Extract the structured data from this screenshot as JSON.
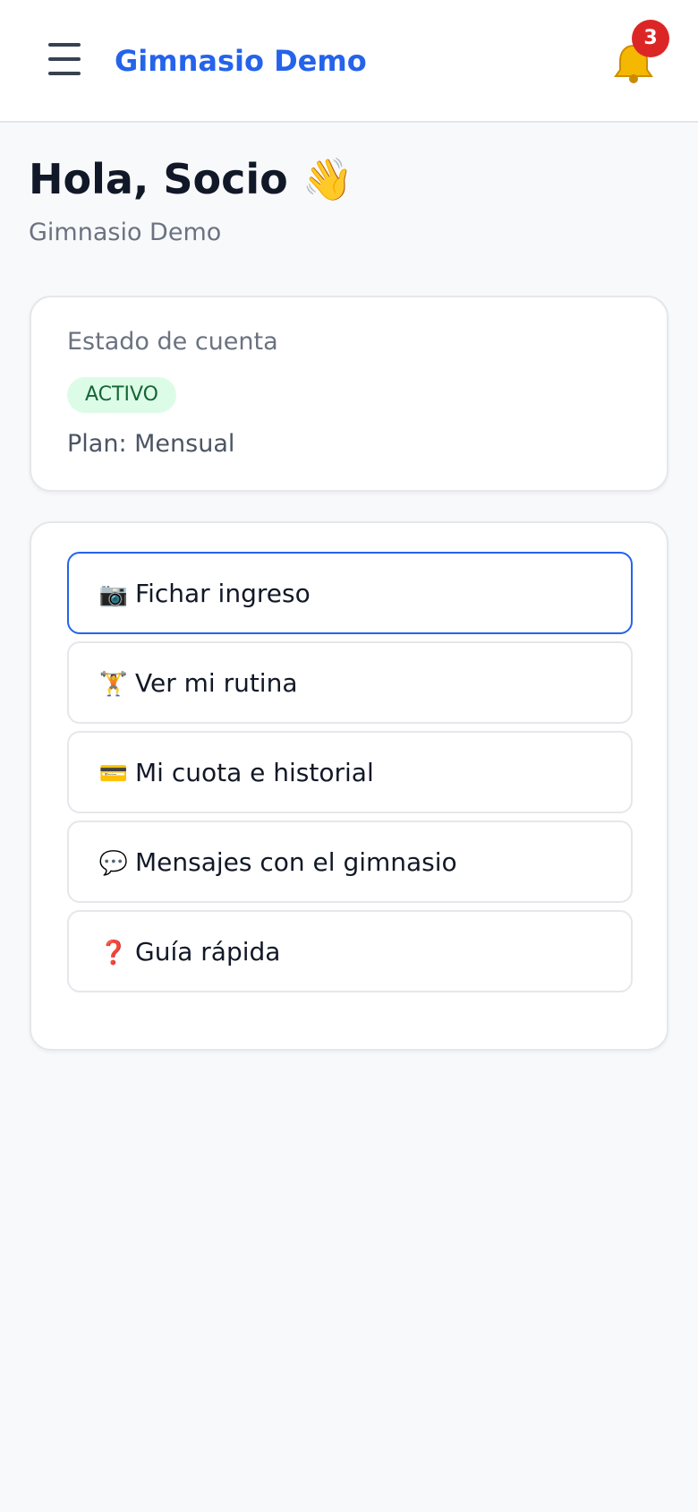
{
  "header": {
    "brand": "Gimnasio Demo",
    "menu_icon": "hamburger-menu-icon",
    "bell_icon": "bell-icon",
    "notification_count": "3"
  },
  "greeting": {
    "text": "Hola, Socio",
    "emoji": "👋",
    "gym_name": "Gimnasio Demo"
  },
  "account": {
    "label": "Estado de cuenta",
    "status": "ACTIVO",
    "plan": "Plan: Mensual"
  },
  "actions": [
    {
      "icon": "📷",
      "icon_name": "camera-icon",
      "label": "Fichar ingreso"
    },
    {
      "icon": "🏋",
      "icon_name": "weightlifter-icon",
      "label": "Ver mi rutina"
    },
    {
      "icon": "💳",
      "icon_name": "credit-card-icon",
      "label": "Mi cuota e historial"
    },
    {
      "icon": "💬",
      "icon_name": "speech-bubble-icon",
      "label": "Mensajes con el gimnasio"
    },
    {
      "icon": "❓",
      "icon_name": "question-mark-icon",
      "label": "Guía rápida"
    }
  ],
  "colors": {
    "brand": "#2563eb",
    "badge": "#dc2626",
    "status_bg": "#dcfce7",
    "status_text": "#166534",
    "background": "#f8f9fb"
  }
}
